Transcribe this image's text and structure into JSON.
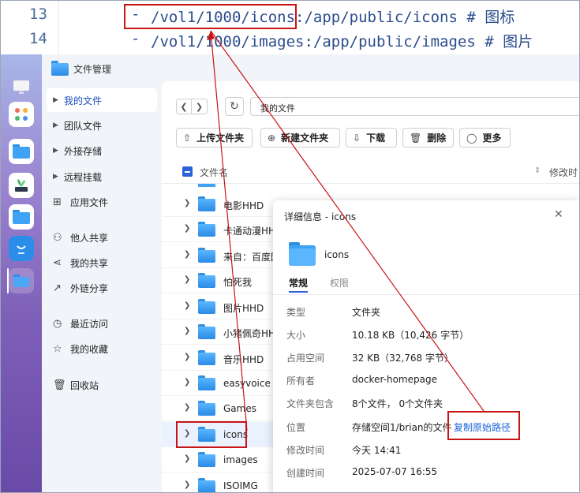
{
  "code": {
    "lines": [
      {
        "num": "13",
        "dash": "-",
        "path_hl": "/vol1/1000/icons:",
        "path_rest": "/app/public/icons",
        "comment": "# 图标"
      },
      {
        "num": "14",
        "dash": "-",
        "path_hl": "/vol1/1000/images:",
        "path_rest": "/app/public/images",
        "comment": "# 图片"
      }
    ]
  },
  "app": {
    "title": "文件管理"
  },
  "dock": {
    "items": [
      "monitor-icon",
      "apps-icon",
      "file-manager-icon",
      "plant-icon",
      "files-icon",
      "chat-icon",
      "folder-icon"
    ]
  },
  "sidebar": {
    "items": [
      {
        "label": "我的文件",
        "icon": "caret-right-icon",
        "active": true
      },
      {
        "label": "团队文件",
        "icon": "caret-right-icon"
      },
      {
        "label": "外接存储",
        "icon": "caret-right-icon"
      },
      {
        "label": "远程挂载",
        "icon": "caret-right-icon"
      },
      {
        "label": "应用文件",
        "icon": "grid-icon"
      },
      {
        "label": "他人共享",
        "icon": "user-icon"
      },
      {
        "label": "我的共享",
        "icon": "share-icon"
      },
      {
        "label": "外链分享",
        "icon": "external-link-icon"
      },
      {
        "label": "最近访问",
        "icon": "clock-icon"
      },
      {
        "label": "我的收藏",
        "icon": "star-icon"
      },
      {
        "label": "回收站",
        "icon": "trash-icon"
      }
    ]
  },
  "toolbar": {
    "path": "我的文件",
    "upload_label": "上传文件夹",
    "new_folder_label": "新建文件夹",
    "download_label": "下载",
    "delete_label": "删除",
    "more_label": "更多"
  },
  "table": {
    "col_name": "文件名",
    "col_modified": "修改时",
    "rows": [
      {
        "name": "电影HHD"
      },
      {
        "name": "卡通动漫HH"
      },
      {
        "name": "来自：百度网"
      },
      {
        "name": "怕死我"
      },
      {
        "name": "图片HHD"
      },
      {
        "name": "小猪佩奇HH"
      },
      {
        "name": "音乐HHD"
      },
      {
        "name": "easyvoice"
      },
      {
        "name": "Games"
      },
      {
        "name": "icons"
      },
      {
        "name": "images"
      },
      {
        "name": "ISOIMG"
      }
    ]
  },
  "dialog": {
    "title": "详细信息 - icons",
    "name": "icons",
    "tab_general": "常规",
    "tab_permissions": "权限",
    "props": [
      {
        "k": "类型",
        "v": "文件夹"
      },
      {
        "k": "大小",
        "v": "10.18 KB（10,426 字节）"
      },
      {
        "k": "占用空间",
        "v": "32 KB（32,768 字节）"
      },
      {
        "k": "所有者",
        "v": "docker-homepage"
      },
      {
        "k": "文件夹包含",
        "v": "8个文件， 0个文件夹"
      },
      {
        "k": "位置",
        "v": "存储空间1/brian的文件"
      },
      {
        "k": "修改时间",
        "v": "今天 14:41"
      },
      {
        "k": "创建时间",
        "v": "2025-07-07 16:55"
      }
    ],
    "copy_link": "复制原始路径"
  },
  "colors": {
    "accent": "#2b62d8",
    "highlight": "#c81414",
    "link": "#1a63d8"
  }
}
